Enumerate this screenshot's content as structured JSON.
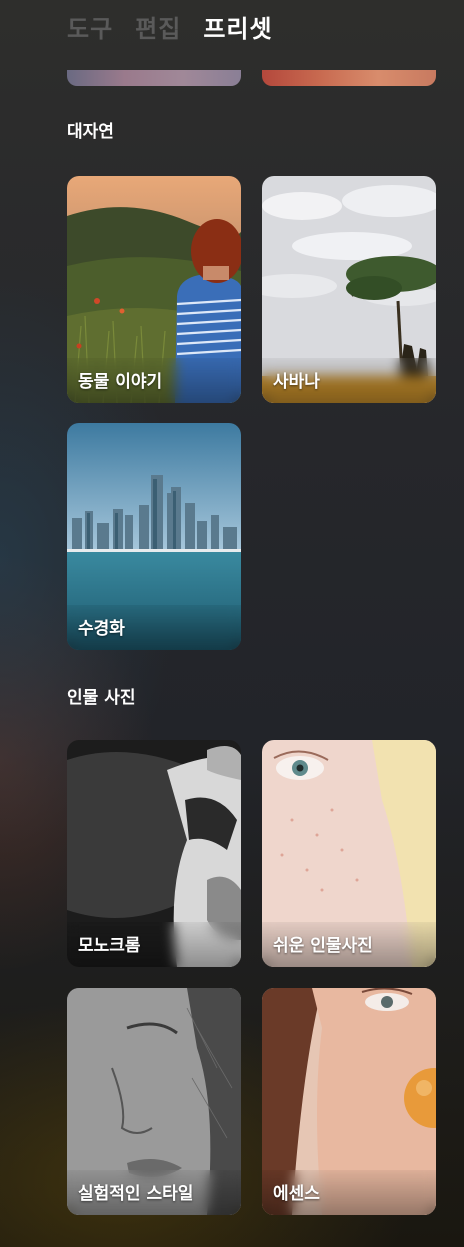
{
  "tabs": [
    {
      "label": "도구",
      "active": false
    },
    {
      "label": "편집",
      "active": false
    },
    {
      "label": "프리셋",
      "active": true
    }
  ],
  "sections": [
    {
      "title": "대자연",
      "presets": [
        {
          "label": "동물 이야기",
          "image": "woman-in-field"
        },
        {
          "label": "사바나",
          "image": "acacia-tree-giraffe"
        },
        {
          "label": "수경화",
          "image": "city-skyline-water"
        }
      ]
    },
    {
      "title": "인물 사진",
      "presets": [
        {
          "label": "모노크롬",
          "image": "monochrome-portrait"
        },
        {
          "label": "쉬운 인물사진",
          "image": "freckled-face-closeup"
        },
        {
          "label": "실험적인 스타일",
          "image": "bw-face-closeup"
        },
        {
          "label": "에센스",
          "image": "woman-bubblegum"
        }
      ]
    }
  ]
}
